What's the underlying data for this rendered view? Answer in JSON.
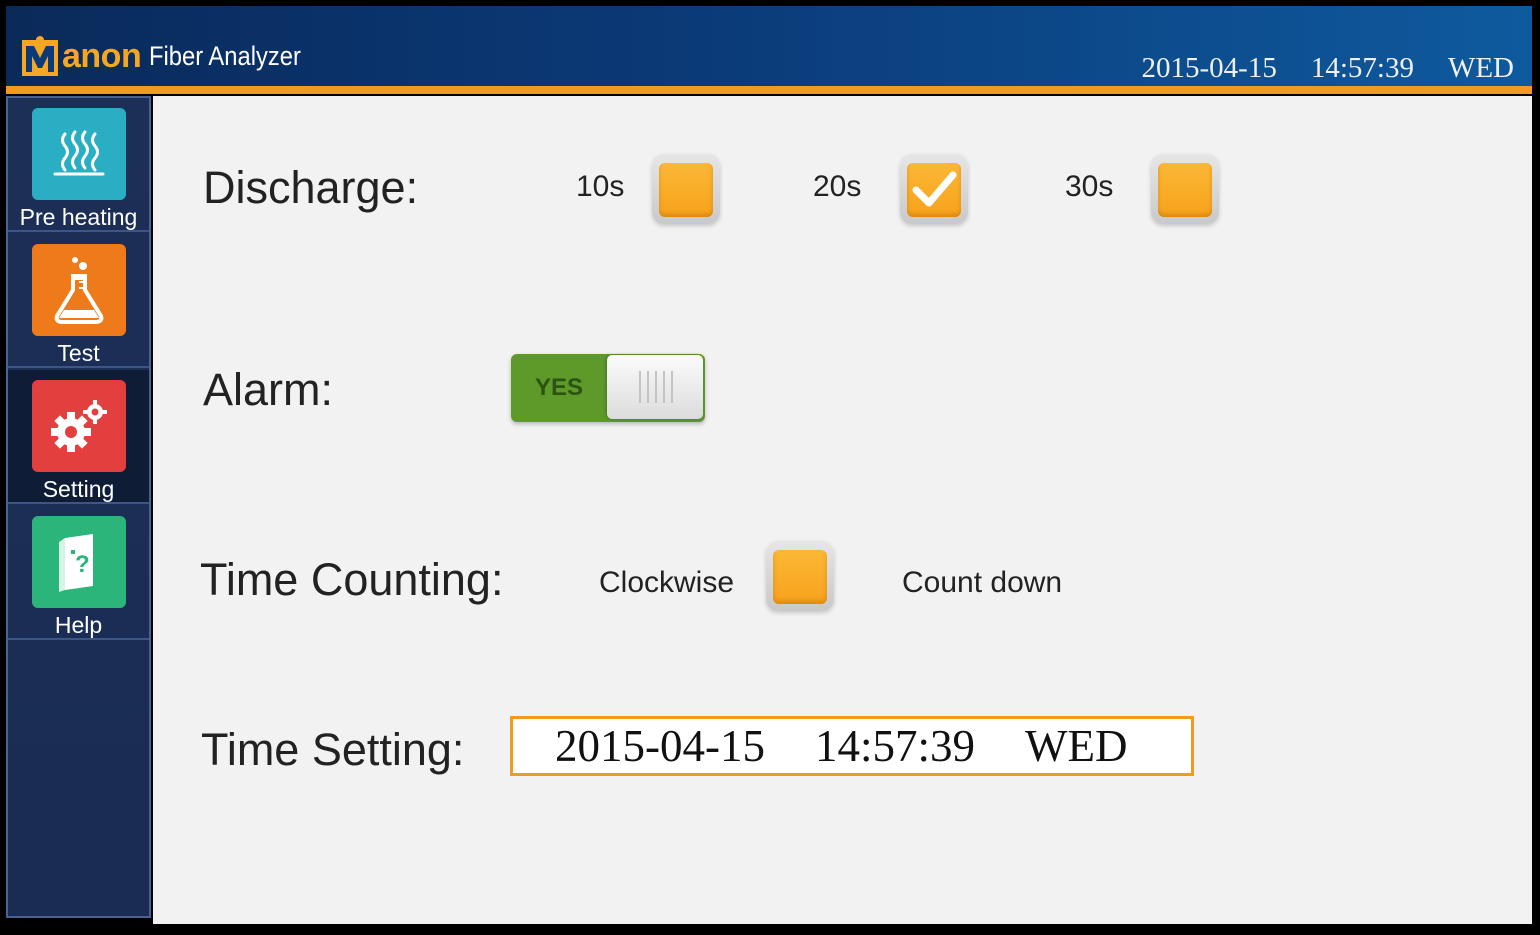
{
  "header": {
    "logo_text": "anon",
    "app_title": "Fiber Analyzer",
    "date": "2015-04-15",
    "time": "14:57:39",
    "weekday": "WED"
  },
  "sidebar": {
    "items": [
      {
        "label": "Pre heating",
        "icon": "heater-icon",
        "color": "#2aaec3",
        "active": false
      },
      {
        "label": "Test",
        "icon": "flask-icon",
        "color": "#ef7a1a",
        "active": false
      },
      {
        "label": "Setting",
        "icon": "gears-icon",
        "color": "#e43f3f",
        "active": true
      },
      {
        "label": "Help",
        "icon": "help-book-icon",
        "color": "#2bb57a",
        "active": false
      }
    ]
  },
  "settings": {
    "discharge": {
      "label": "Discharge:",
      "options": [
        {
          "label": "10s",
          "checked": false
        },
        {
          "label": "20s",
          "checked": true
        },
        {
          "label": "30s",
          "checked": false
        }
      ]
    },
    "alarm": {
      "label": "Alarm:",
      "toggle_text": "YES",
      "on": true
    },
    "time_counting": {
      "label": "Time Counting:",
      "options": [
        {
          "label": "Clockwise",
          "checked": false
        },
        {
          "label": "Count down"
        }
      ]
    },
    "time_setting": {
      "label": "Time Setting:",
      "date": "2015-04-15",
      "time": "14:57:39",
      "weekday": "WED"
    }
  },
  "colors": {
    "accent": "#f29a20",
    "checkbox": "#f7a21c",
    "toggle_on": "#5e9a2a",
    "sidebar_bg": "#1c2f57"
  }
}
